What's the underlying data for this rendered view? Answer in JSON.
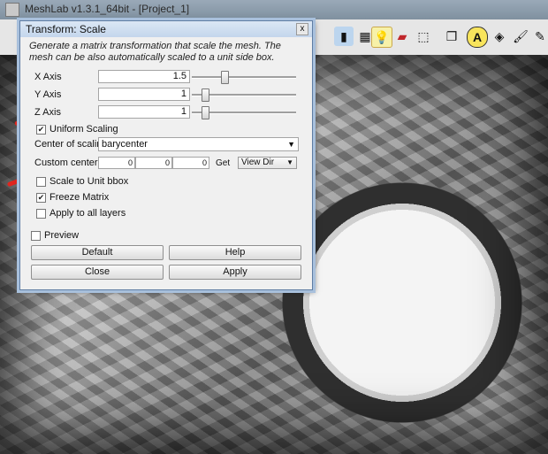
{
  "app": {
    "title": "MeshLab v1.3.1_64bit - [Project_1]"
  },
  "dialog": {
    "title": "Transform: Scale",
    "close_glyph": "x",
    "description": "Generate a matrix transformation that scale the mesh. The mesh can be also automatically scaled to a unit side box.",
    "x_axis": {
      "label": "X Axis",
      "value": "1.5"
    },
    "y_axis": {
      "label": "Y Axis",
      "value": "1"
    },
    "z_axis": {
      "label": "Z Axis",
      "value": "1"
    },
    "uniform_scaling": {
      "label": "Uniform Scaling",
      "checked": true
    },
    "center": {
      "label": "Center of scaling:",
      "selected": "barycenter"
    },
    "custom_center": {
      "label": "Custom center",
      "x": "0",
      "y": "0",
      "z": "0",
      "get_label": "Get",
      "view_dir": "View Dir"
    },
    "scale_unit_bbox": {
      "label": "Scale to Unit bbox",
      "checked": false
    },
    "freeze_matrix": {
      "label": "Freeze Matrix",
      "checked": true
    },
    "apply_all": {
      "label": "Apply to all layers",
      "checked": false
    },
    "preview": {
      "label": "Preview",
      "checked": false
    },
    "buttons": {
      "default": "Default",
      "help": "Help",
      "close": "Close",
      "apply": "Apply"
    }
  },
  "icons": [
    "app-icon",
    "box-icon",
    "lightbulb-icon",
    "red-tool-icon",
    "grid-icon",
    "cube-icon",
    "annotation-a-icon",
    "sphere-icon",
    "paint-icon",
    "brush-icon"
  ]
}
